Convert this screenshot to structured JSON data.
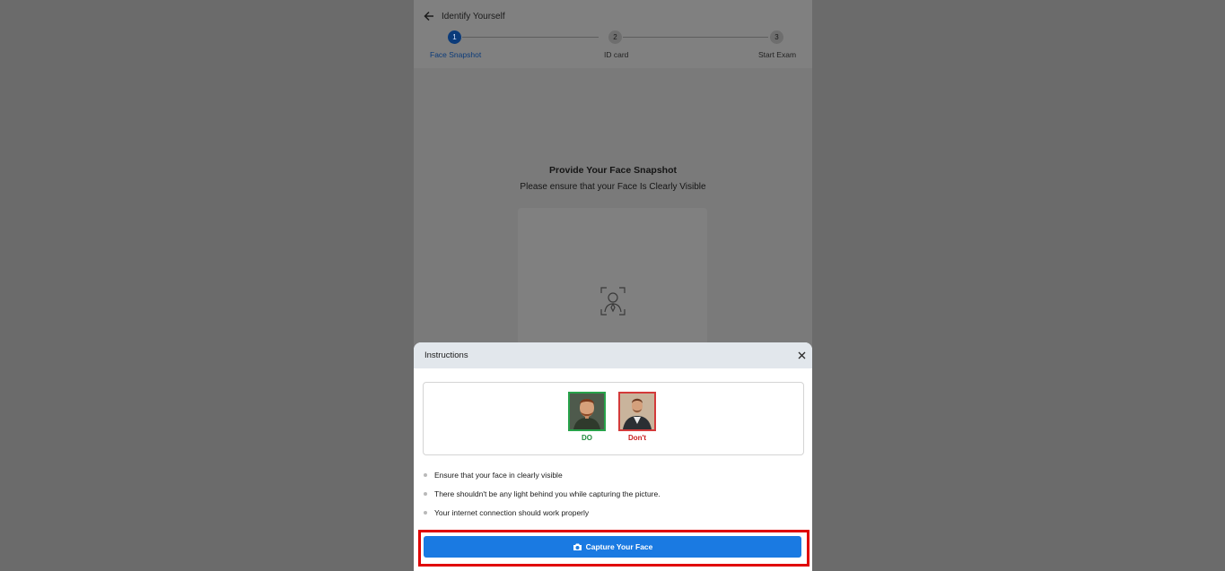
{
  "header": {
    "title": "Identify Yourself",
    "steps": [
      {
        "number": "1",
        "label": "Face Snapshot",
        "state": "active"
      },
      {
        "number": "2",
        "label": "ID card",
        "state": "inactive"
      },
      {
        "number": "3",
        "label": "Start Exam",
        "state": "inactive"
      }
    ]
  },
  "main": {
    "title": "Provide Your Face Snapshot",
    "subtitle": "Please ensure that your Face Is Clearly Visible"
  },
  "modal": {
    "title": "Instructions",
    "examples": [
      {
        "label": "DO",
        "kind": "good"
      },
      {
        "label": "Don't",
        "kind": "bad"
      }
    ],
    "instructions": [
      "Ensure that your face in clearly visible",
      "There shouldn't be any light behind you while capturing the picture.",
      "Your internet connection should work properly"
    ],
    "capture_button_label": "Capture Your Face"
  },
  "colors": {
    "accent": "#1a7ae2",
    "step_active": "#0b3b7a",
    "good": "#27a24a",
    "bad": "#d33a3a",
    "highlight": "#e00000"
  }
}
